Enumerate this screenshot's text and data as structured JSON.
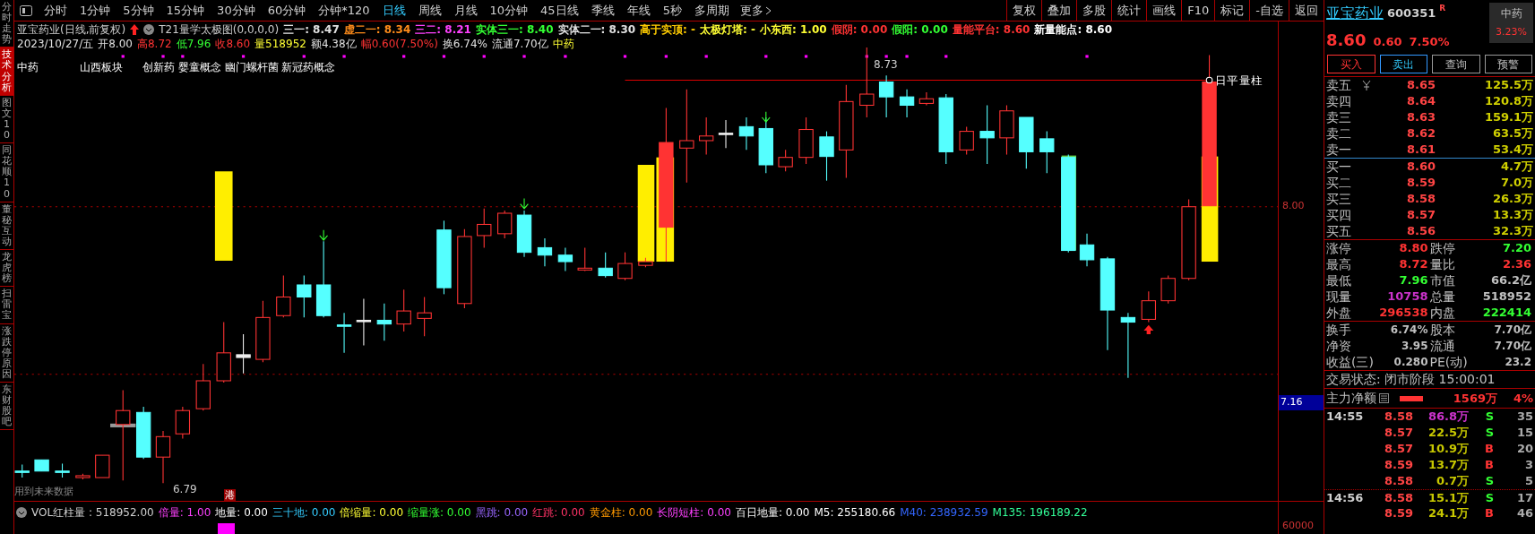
{
  "sidebar": {
    "tabs": [
      {
        "label": "分时走势",
        "selected": false
      },
      {
        "label": "技术分析",
        "selected": true
      },
      {
        "label": "图文10",
        "selected": false
      },
      {
        "label": "同花顺10",
        "selected": false
      },
      {
        "label": "董秘互动",
        "selected": false
      },
      {
        "label": "龙虎榜",
        "selected": false
      },
      {
        "label": "扫雷宝",
        "selected": false
      },
      {
        "label": "涨跌停原因",
        "selected": false
      },
      {
        "label": "东财股吧",
        "selected": false
      }
    ]
  },
  "toolbar": {
    "periods": [
      {
        "label": "分时",
        "selected": false
      },
      {
        "label": "1分钟",
        "selected": false
      },
      {
        "label": "5分钟",
        "selected": false
      },
      {
        "label": "15分钟",
        "selected": false
      },
      {
        "label": "30分钟",
        "selected": false
      },
      {
        "label": "60分钟",
        "selected": false
      },
      {
        "label": "分钟*120",
        "selected": false
      },
      {
        "label": "日线",
        "selected": true
      },
      {
        "label": "周线",
        "selected": false
      },
      {
        "label": "月线",
        "selected": false
      },
      {
        "label": "10分钟",
        "selected": false
      },
      {
        "label": "45日线",
        "selected": false
      },
      {
        "label": "季线",
        "selected": false
      },
      {
        "label": "年线",
        "selected": false
      },
      {
        "label": "5秒",
        "selected": false
      },
      {
        "label": "多周期",
        "selected": false
      }
    ],
    "more": "更多",
    "actions": [
      "复权",
      "叠加",
      "多股",
      "统计",
      "画线",
      "F10",
      "标记",
      "-自选",
      "返回"
    ]
  },
  "chart": {
    "title": "亚宝药业(日线,前复权)",
    "indicator": "T21量学太极图(0,0,0,0)",
    "indicator_values": [
      {
        "text": "三一: 8.47",
        "color": "#e0e0e0"
      },
      {
        "text": "虚二一: 8.34",
        "color": "#ff8c1a"
      },
      {
        "text": "三二: 8.21",
        "color": "#ff40ff"
      },
      {
        "text": "实体三一: 8.40",
        "color": "#33ff33"
      },
      {
        "text": "实体二一: 8.30",
        "color": "#e0e0e0"
      },
      {
        "text": "高于实顶: -",
        "color": "#ffcc00"
      },
      {
        "text": "太极灯塔: -",
        "color": "#ffff33"
      },
      {
        "text": "小东西: 1.00",
        "color": "#ffff33"
      },
      {
        "text": "假阴: 0.00",
        "color": "#ff3333"
      },
      {
        "text": "假阳: 0.00",
        "color": "#33ff33"
      },
      {
        "text": "量能平台: 8.60",
        "color": "#ff3333"
      },
      {
        "text": "新量能点: 8.60",
        "color": "#ffffff"
      }
    ],
    "quote": [
      {
        "text": "2023/10/27/五",
        "color": "#e0e0e0"
      },
      {
        "text": "开8.00",
        "color": "#e0e0e0"
      },
      {
        "text": "高8.72",
        "color": "#ff3333"
      },
      {
        "text": "低7.96",
        "color": "#33ff33"
      },
      {
        "text": "收8.60",
        "color": "#ff3333"
      },
      {
        "text": "量518952",
        "color": "#ffff33"
      },
      {
        "text": "额4.38亿",
        "color": "#e0e0e0"
      },
      {
        "text": "幅0.60(7.50%)",
        "color": "#ff3333"
      },
      {
        "text": "换6.74%",
        "color": "#e0e0e0"
      },
      {
        "text": "流通7.70亿",
        "color": "#e0e0e0"
      },
      {
        "text": "中药",
        "color": "#ffff33"
      }
    ],
    "tags": [
      "中药",
      "山西板块",
      "创新药 婴童概念 幽门螺杆菌 新冠药概念"
    ],
    "high_label": "8.73",
    "low_label": "6.79",
    "bar_label": "日平量柱",
    "note": "用到未来数据",
    "hk_badge": "港",
    "price_axis": [
      "8.00",
      "7.16"
    ]
  },
  "volume": {
    "title": "VOL红柱量 : 518952.00",
    "items": [
      {
        "text": "倍量: 1.00",
        "color": "#ff40ff"
      },
      {
        "text": "地量: 0.00",
        "color": "#ffffff"
      },
      {
        "text": "三十地: 0.00",
        "color": "#33ccff"
      },
      {
        "text": "倍缩量: 0.00",
        "color": "#ffff33"
      },
      {
        "text": "缩量涨: 0.00",
        "color": "#33ff33"
      },
      {
        "text": "黑跳: 0.00",
        "color": "#9966ff"
      },
      {
        "text": "红跳: 0.00",
        "color": "#ff3366"
      },
      {
        "text": "黄金柱: 0.00",
        "color": "#ff9900"
      },
      {
        "text": "长阴短柱: 0.00",
        "color": "#ff40ff"
      },
      {
        "text": "百日地量: 0.00",
        "color": "#ffffff"
      },
      {
        "text": "M5: 255180.66",
        "color": "#ffffff"
      },
      {
        "text": "M40: 238932.59",
        "color": "#3366ff"
      },
      {
        "text": "M135: 196189.22",
        "color": "#33ff99"
      }
    ],
    "axis": "60000"
  },
  "stock": {
    "name": "亚宝药业",
    "code": "600351",
    "flag": "R",
    "sector": "中药",
    "sector_change": "3.23%",
    "price": "8.60",
    "change": "0.60",
    "change_pct": "7.50%",
    "buttons": [
      {
        "label": "买入",
        "kind": "buy"
      },
      {
        "label": "卖出",
        "kind": "sell"
      },
      {
        "label": "查询",
        "kind": "plain"
      },
      {
        "label": "预警",
        "kind": "plain"
      }
    ],
    "asks": [
      {
        "label": "卖五",
        "price": "8.65",
        "volume": "125.5万"
      },
      {
        "label": "卖四",
        "price": "8.64",
        "volume": "120.8万"
      },
      {
        "label": "卖三",
        "price": "8.63",
        "volume": "159.1万"
      },
      {
        "label": "卖二",
        "price": "8.62",
        "volume": "63.5万"
      },
      {
        "label": "卖一",
        "price": "8.61",
        "volume": "53.4万"
      }
    ],
    "bids": [
      {
        "label": "买一",
        "price": "8.60",
        "volume": "4.7万"
      },
      {
        "label": "买二",
        "price": "8.59",
        "volume": "7.0万"
      },
      {
        "label": "买三",
        "price": "8.58",
        "volume": "26.3万"
      },
      {
        "label": "买四",
        "price": "8.57",
        "volume": "13.3万"
      },
      {
        "label": "买五",
        "price": "8.56",
        "volume": "32.3万"
      }
    ],
    "stats": [
      [
        {
          "label": "涨停",
          "value": "8.80",
          "color": "#ff3333"
        },
        {
          "label": "跌停",
          "value": "7.20",
          "color": "#33ff33"
        }
      ],
      [
        {
          "label": "最高",
          "value": "8.72",
          "color": "#ff3333"
        },
        {
          "label": "量比",
          "value": "2.36",
          "color": "#ff3333"
        }
      ],
      [
        {
          "label": "最低",
          "value": "7.96",
          "color": "#33ff33"
        },
        {
          "label": "市值",
          "value": "66.2亿",
          "color": "#c0c0c0"
        }
      ],
      [
        {
          "label": "现量",
          "value": "10758",
          "color": "#cc33cc"
        },
        {
          "label": "总量",
          "value": "518952",
          "color": "#c0c0c0"
        }
      ],
      [
        {
          "label": "外盘",
          "value": "296538",
          "color": "#ff3333"
        },
        {
          "label": "内盘",
          "value": "222414",
          "color": "#33ff33"
        }
      ]
    ],
    "fundamentals": [
      [
        {
          "label": "换手",
          "value": "6.74%"
        },
        {
          "label": "股本",
          "value": "7.70亿"
        }
      ],
      [
        {
          "label": "净资",
          "value": "3.95"
        },
        {
          "label": "流通",
          "value": "7.70亿"
        }
      ],
      [
        {
          "label": "收益(三)",
          "value": "0.280"
        },
        {
          "label": "PE(动)",
          "value": "23.2"
        }
      ]
    ],
    "status": "交易状态: 闭市阶段 15:00:01",
    "main_force": {
      "label": "主力净额",
      "value": "1569万",
      "pct": "4%"
    },
    "ticks": [
      {
        "time": "14:55",
        "price": "8.58",
        "volume": "86.8万",
        "color": "#cc33cc",
        "side": "S",
        "kind": "sell",
        "count": "35"
      },
      {
        "price": "8.57",
        "volume": "22.5万",
        "color": "#c8c800",
        "side": "S",
        "kind": "sell",
        "count": "15"
      },
      {
        "price": "8.57",
        "volume": "10.9万",
        "color": "#c8c800",
        "side": "B",
        "kind": "buy",
        "count": "20"
      },
      {
        "price": "8.59",
        "volume": "13.7万",
        "color": "#c8c800",
        "side": "B",
        "kind": "buy",
        "count": "3"
      },
      {
        "price": "8.58",
        "volume": "0.7万",
        "color": "#c8c800",
        "side": "S",
        "kind": "sell",
        "count": "5"
      },
      {
        "time": "14:56",
        "price": "8.58",
        "volume": "15.1万",
        "color": "#c8c800",
        "side": "S",
        "kind": "sell",
        "count": "17"
      },
      {
        "price": "8.59",
        "volume": "24.1万",
        "color": "#c8c800",
        "side": "B",
        "kind": "buy",
        "count": "46"
      }
    ]
  }
}
